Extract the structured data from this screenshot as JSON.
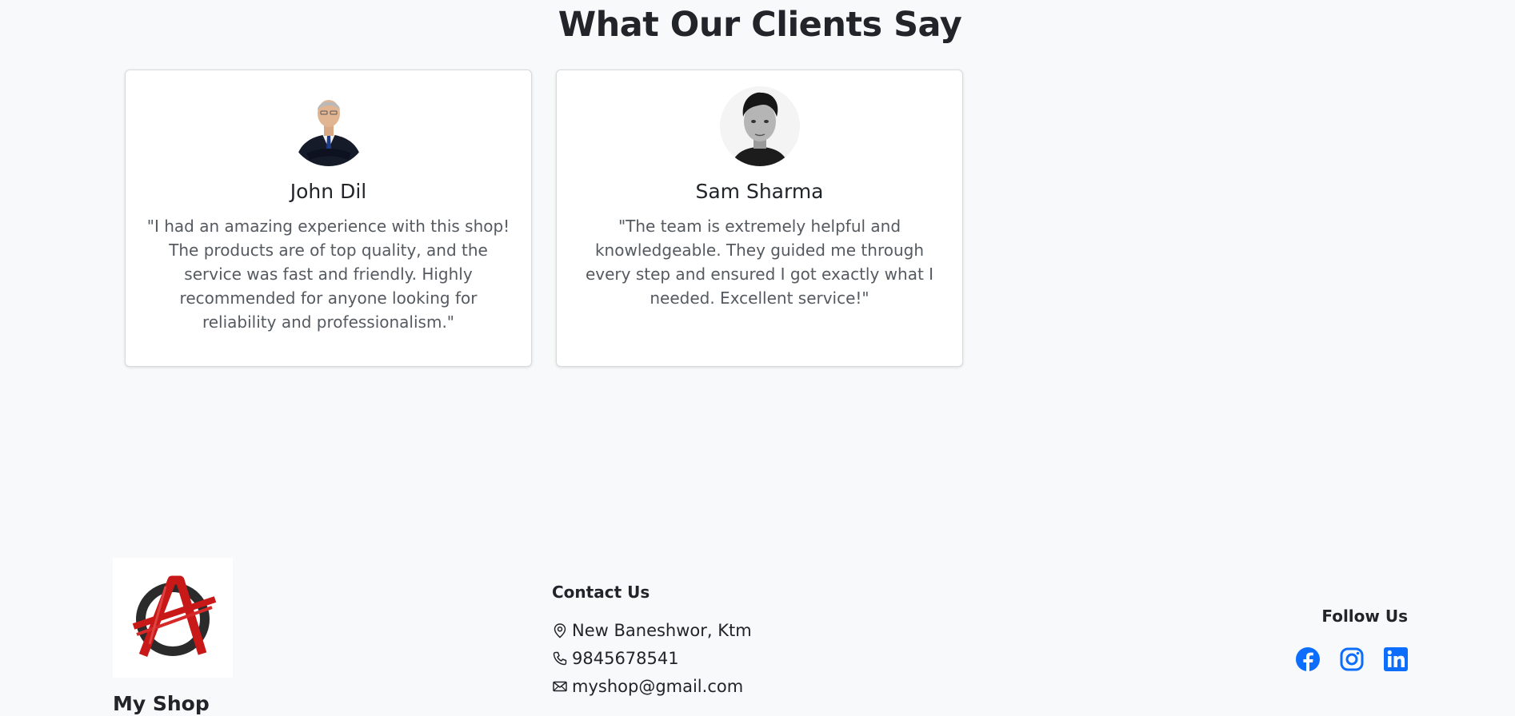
{
  "testimonials": {
    "title": "What Our Clients Say",
    "items": [
      {
        "name": "John Dil",
        "quote": "\"I had an amazing experience with this shop! The products are of top quality, and the service was fast and friendly. Highly recommended for anyone looking for reliability and professionalism.\"",
        "avatar": "businessman-photo"
      },
      {
        "name": "Sam Sharma",
        "quote": "\"The team is extremely helpful and knowledgeable. They guided me through every step and ensured I got exactly what I needed. Excellent service!\"",
        "avatar": "man-portrait-photo"
      }
    ]
  },
  "footer": {
    "logo_icon": "anarchy-a-logo",
    "brand": "My Shop",
    "contact": {
      "title": "Contact Us",
      "address": "New Baneshwor, Ktm",
      "phone": "9845678541",
      "email": "myshop@gmail.com"
    },
    "follow": {
      "title": "Follow Us",
      "icons": [
        "facebook-icon",
        "instagram-icon",
        "linkedin-icon"
      ],
      "accent": "#0d6efd"
    }
  }
}
